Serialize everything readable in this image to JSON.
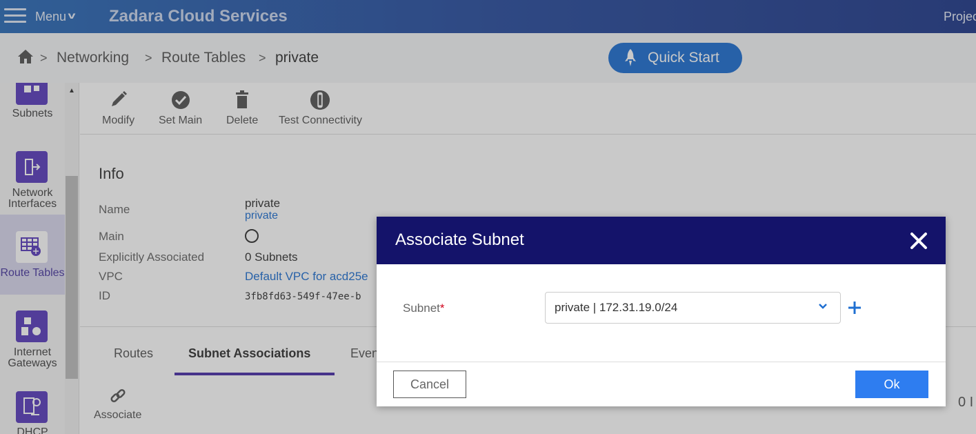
{
  "header": {
    "menu_label": "Menu",
    "brand": "Zadara Cloud Services",
    "project_partial": "Projec"
  },
  "breadcrumb": {
    "items": [
      "Networking",
      "Route Tables",
      "private"
    ],
    "quick_start": "Quick Start"
  },
  "sidebar": {
    "items": [
      {
        "label": "Subnets",
        "icon": "subnets-icon"
      },
      {
        "label": "Network Interfaces",
        "icon": "network-interfaces-icon"
      },
      {
        "label": "Route Tables",
        "icon": "route-tables-icon",
        "active": true
      },
      {
        "label": "Internet Gateways",
        "icon": "internet-gateways-icon"
      },
      {
        "label": "DHCP",
        "icon": "dhcp-icon"
      }
    ]
  },
  "toolbar": {
    "modify": "Modify",
    "set_main": "Set Main",
    "delete": "Delete",
    "test_connectivity": "Test Connectivity"
  },
  "info": {
    "title": "Info",
    "name_label": "Name",
    "name_value": "private",
    "name_sub": "private",
    "main_label": "Main",
    "explicit_label": "Explicitly Associated",
    "explicit_value": "0 Subnets",
    "vpc_label": "VPC",
    "vpc_value": "Default VPC for acd25e",
    "id_label": "ID",
    "id_value": "3fb8fd63-549f-47ee-b"
  },
  "tabs": {
    "routes": "Routes",
    "subnet_associations": "Subnet Associations",
    "events_partial": "Even"
  },
  "associate": {
    "label": "Associate",
    "right_partial": "0 I"
  },
  "modal": {
    "title": "Associate Subnet",
    "subnet_label": "Subnet",
    "required_mark": "*",
    "subnet_value": "private | 172.31.19.0/24",
    "cancel": "Cancel",
    "ok": "Ok"
  },
  "colors": {
    "header_bg": "#14136a",
    "accent": "#1f6fd1",
    "ok_button": "#2e7df0",
    "sidebar_icon": "#5a3dbd",
    "tab_underline": "#4a2ea8"
  }
}
